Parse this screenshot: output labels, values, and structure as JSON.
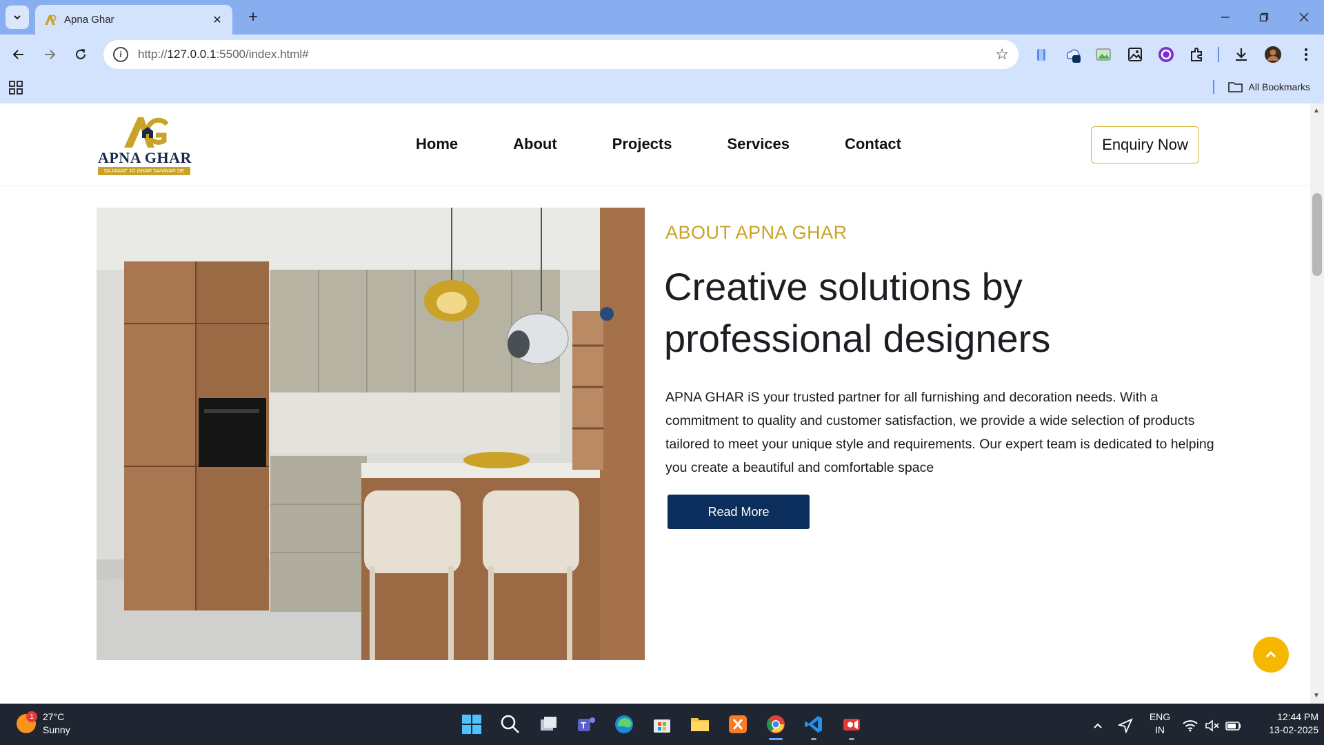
{
  "browser": {
    "tab_title": "Apna Ghar",
    "url_prefix": "http://",
    "url_host": "127.0.0.1",
    "url_rest": ":5500/index.html#",
    "bookmarks_label": "All Bookmarks"
  },
  "site": {
    "logo_text": "APNA GHAR",
    "logo_tagline": "SAJAWAT JO GHAR SANWAR DE",
    "nav": [
      "Home",
      "About",
      "Projects",
      "Services",
      "Contact"
    ],
    "enquiry_label": "Enquiry Now"
  },
  "about": {
    "kicker": "ABOUT APNA GHAR",
    "title_line1": "Creative solutions by",
    "title_line2": "professional designers",
    "body": "APNA GHAR iS your trusted partner for all furnishing and decoration needs. With a commitment to quality and customer satisfaction, we provide a wide selection of products tailored to meet your unique style and requirements. Our expert team is dedicated to helping you create a beautiful and comfortable space",
    "button_label": "Read More"
  },
  "taskbar": {
    "weather_temp": "27°C",
    "weather_desc": "Sunny",
    "weather_badge": "1",
    "lang_line1": "ENG",
    "lang_line2": "IN",
    "time": "12:44 PM",
    "date": "13-02-2025"
  },
  "colors": {
    "accent_gold": "#c9a227",
    "button_navy": "#0b2e5c",
    "back_to_top": "#f5b700"
  }
}
